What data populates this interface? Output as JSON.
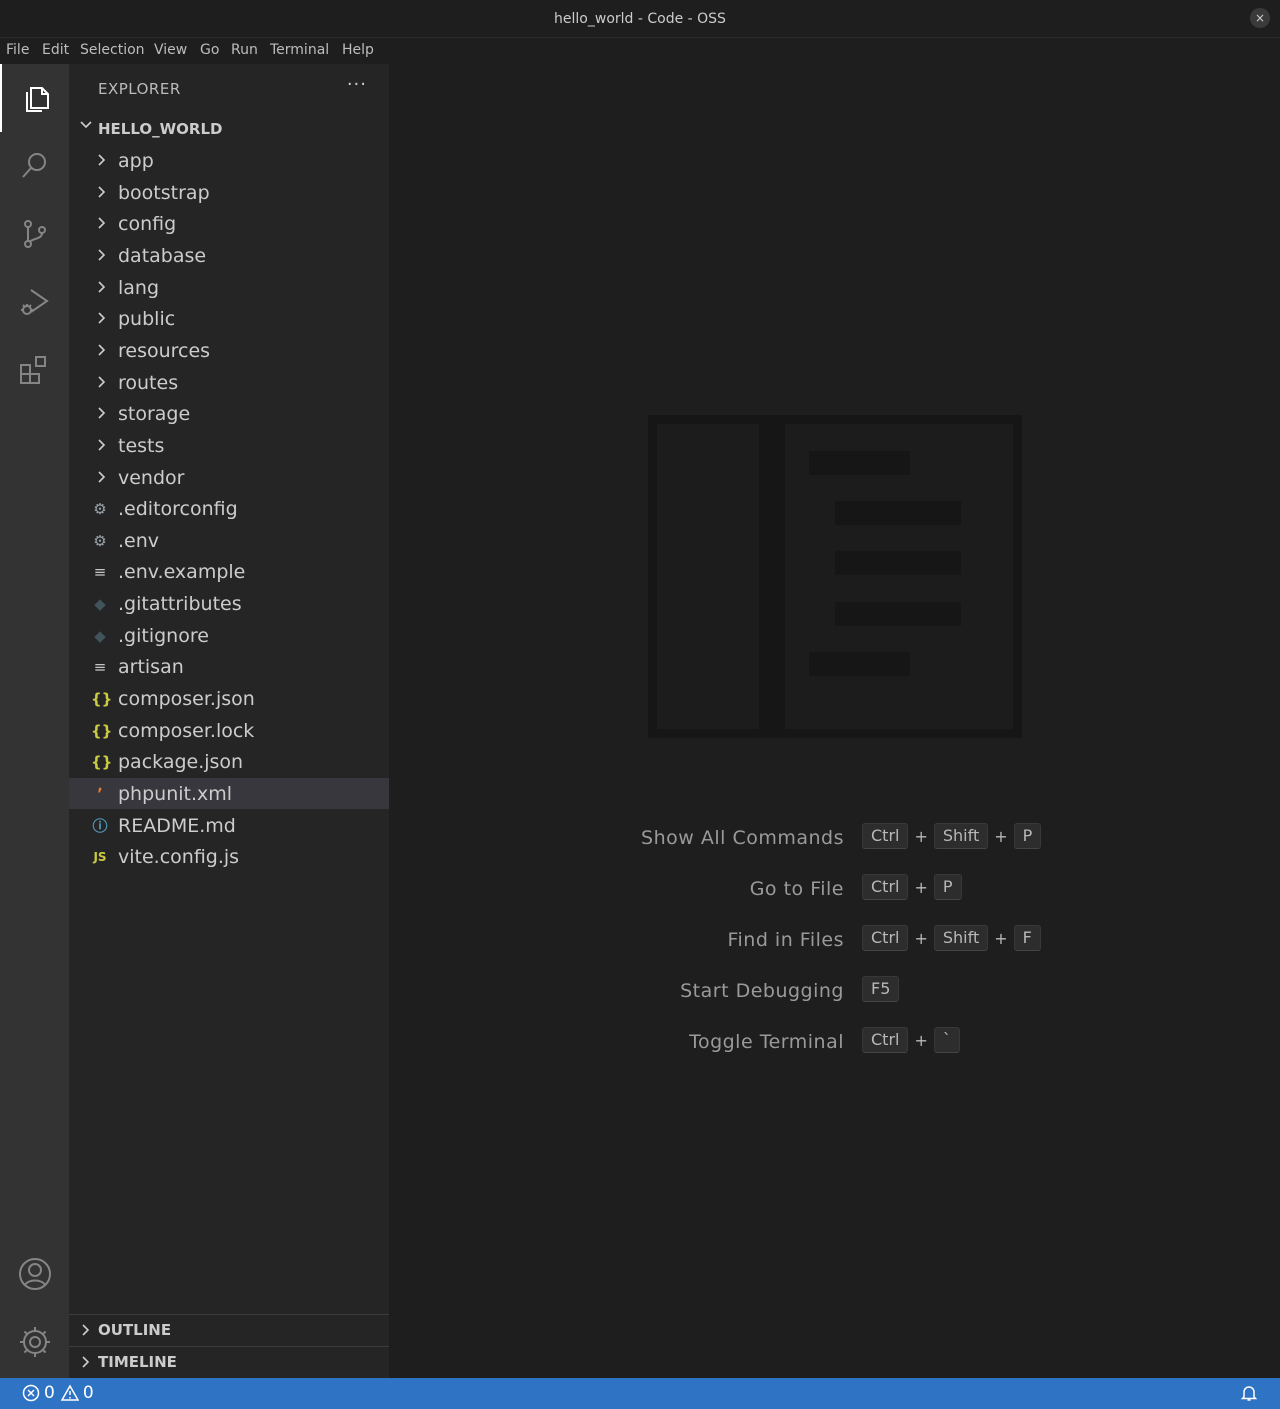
{
  "window": {
    "title": "hello_world - Code - OSS",
    "close_glyph": "×"
  },
  "menu": [
    "File",
    "Edit",
    "Selection",
    "View",
    "Go",
    "Run",
    "Terminal",
    "Help"
  ],
  "activity_bar": {
    "top": [
      "explorer-icon",
      "search-icon",
      "source-control-icon",
      "run-debug-icon",
      "extensions-icon"
    ],
    "bottom": [
      "account-icon",
      "settings-gear-icon"
    ]
  },
  "sidebar": {
    "header": "EXPLORER",
    "more_glyph": "···",
    "root": "HELLO_WORLD",
    "folders": [
      "app",
      "bootstrap",
      "config",
      "database",
      "lang",
      "public",
      "resources",
      "routes",
      "storage",
      "tests",
      "vendor"
    ],
    "files": [
      {
        "name": ".editorconfig",
        "icon": "gear",
        "glyph": "⚙",
        "color": "#9aa4ad"
      },
      {
        "name": ".env",
        "icon": "gear",
        "glyph": "⚙",
        "color": "#9aa4ad"
      },
      {
        "name": ".env.example",
        "icon": "lines",
        "glyph": "≡",
        "color": "#c5c5c5"
      },
      {
        "name": ".gitattributes",
        "icon": "git",
        "glyph": "◆",
        "color": "#41535b"
      },
      {
        "name": ".gitignore",
        "icon": "git",
        "glyph": "◆",
        "color": "#41535b"
      },
      {
        "name": "artisan",
        "icon": "lines",
        "glyph": "≡",
        "color": "#c5c5c5"
      },
      {
        "name": "composer.json",
        "icon": "braces",
        "glyph": "{}",
        "color": "#cbcb41"
      },
      {
        "name": "composer.lock",
        "icon": "braces",
        "glyph": "{}",
        "color": "#cbcb41"
      },
      {
        "name": "package.json",
        "icon": "braces",
        "glyph": "{}",
        "color": "#cbcb41"
      },
      {
        "name": "phpunit.xml",
        "icon": "rss",
        "glyph": "ʼ",
        "color": "#e37933"
      },
      {
        "name": "README.md",
        "icon": "info",
        "glyph": "ⓘ",
        "color": "#519aba"
      },
      {
        "name": "vite.config.js",
        "icon": "js",
        "glyph": "JS",
        "color": "#cbcb41"
      }
    ],
    "selected_file": "phpunit.xml",
    "outline": "OUTLINE",
    "timeline": "TIMELINE"
  },
  "editor": {
    "shortcuts": [
      {
        "label": "Show All Commands",
        "keys": [
          "Ctrl",
          "Shift",
          "P"
        ]
      },
      {
        "label": "Go to File",
        "keys": [
          "Ctrl",
          "P"
        ]
      },
      {
        "label": "Find in Files",
        "keys": [
          "Ctrl",
          "Shift",
          "F"
        ]
      },
      {
        "label": "Start Debugging",
        "keys": [
          "F5"
        ]
      },
      {
        "label": "Toggle Terminal",
        "keys": [
          "Ctrl",
          "`"
        ]
      }
    ],
    "plus": "+"
  },
  "status": {
    "errors": "0",
    "warnings": "0"
  },
  "colors": {
    "accent": "#2f73c4",
    "sidebar": "#252526",
    "activity": "#333333",
    "editor": "#1e1e1e",
    "selected_row": "#37373d"
  }
}
